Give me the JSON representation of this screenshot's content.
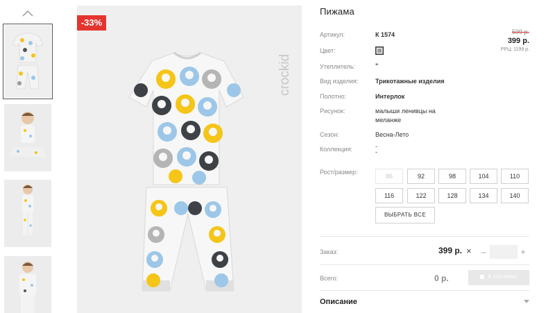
{
  "product": {
    "title": "Пижама",
    "discount_badge": "-33%",
    "brand": "crockid",
    "old_price": "599 р.",
    "price": "399 р.",
    "rrp": "РРЦ: 1199 р."
  },
  "details": [
    {
      "label": "Артикул:",
      "value": "К 1574"
    },
    {
      "label": "Цвет:",
      "value": ""
    },
    {
      "label": "Утеплитель:",
      "value": "\""
    },
    {
      "label": "Вид изделия:",
      "value": "Трикотажные изделия"
    },
    {
      "label": "Полотно:",
      "value": "Интерлок"
    },
    {
      "label": "Рисунок:",
      "value": "малыши ленивцы на меланже"
    },
    {
      "label": "Сезон:",
      "value": "Весна-Лето"
    },
    {
      "label": "Коллекция:",
      "value": "-\n-"
    }
  ],
  "colors": {
    "accent_red": "#e53430",
    "swatch": "#9a9a9a"
  },
  "sizes": {
    "label": "Рост/размер:",
    "options": [
      {
        "value": "86",
        "disabled": true
      },
      {
        "value": "92",
        "disabled": false
      },
      {
        "value": "98",
        "disabled": false
      },
      {
        "value": "104",
        "disabled": false
      },
      {
        "value": "110",
        "disabled": false
      },
      {
        "value": "116",
        "disabled": false
      },
      {
        "value": "122",
        "disabled": false
      },
      {
        "value": "128",
        "disabled": false
      },
      {
        "value": "134",
        "disabled": false
      },
      {
        "value": "140",
        "disabled": false
      }
    ],
    "select_all_label": "ВЫБРАТЬ ВСЕ"
  },
  "order": {
    "label": "Заказ:",
    "price": "399 р.",
    "clear_icon": "×",
    "minus": "–",
    "plus": "+",
    "quantity": ""
  },
  "total": {
    "label": "Всего:",
    "price": "0 р.",
    "cart_button_label": "В КОРЗИНУ"
  },
  "description": {
    "title": "Описание"
  },
  "icons": [
    "chevron-up-icon",
    "cart-icon",
    "close-icon",
    "chevron-down-icon"
  ]
}
